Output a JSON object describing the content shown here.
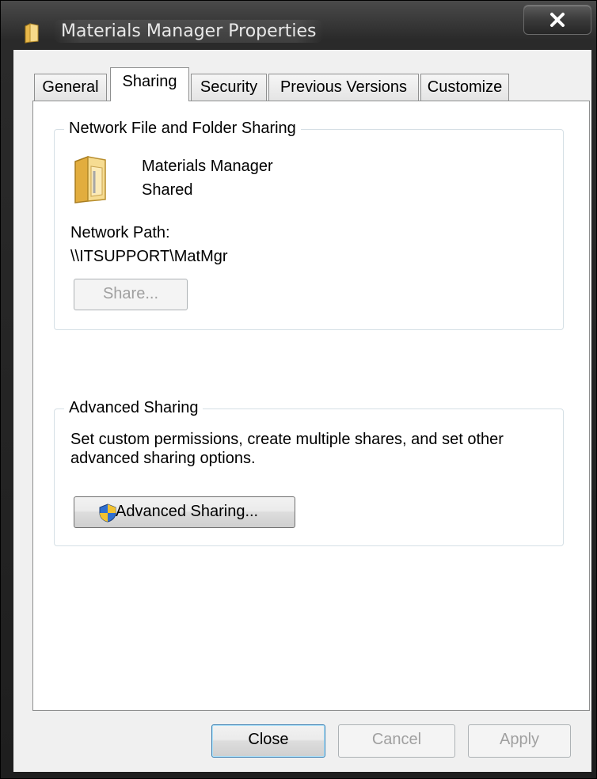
{
  "window": {
    "title": "Materials Manager Properties",
    "close_glyph": "X"
  },
  "tabs": [
    {
      "label": "General",
      "active": false
    },
    {
      "label": "Sharing",
      "active": true
    },
    {
      "label": "Security",
      "active": false
    },
    {
      "label": "Previous Versions",
      "active": false
    },
    {
      "label": "Customize",
      "active": false
    }
  ],
  "network_sharing": {
    "group_label": "Network File and Folder Sharing",
    "folder_name": "Materials Manager",
    "folder_status": "Shared",
    "path_label": "Network Path:",
    "path_value": "\\\\ITSUPPORT\\MatMgr",
    "share_button": "Share...",
    "share_button_enabled": false
  },
  "advanced_sharing": {
    "group_label": "Advanced Sharing",
    "description_line1": "Set custom permissions, create multiple shares, and set other",
    "description_line2": "advanced sharing options.",
    "button_label": "Advanced Sharing...",
    "button_icon": "uac-shield-icon"
  },
  "footer": {
    "close_label": "Close",
    "cancel_label": "Cancel",
    "apply_label": "Apply",
    "cancel_enabled": false,
    "apply_enabled": false
  },
  "colors": {
    "title_bar": "#1e1e1e",
    "dialog_bg": "#f0f0f0",
    "folder_yellow": "#f3d27a",
    "disabled_text": "#a0a0a0"
  }
}
